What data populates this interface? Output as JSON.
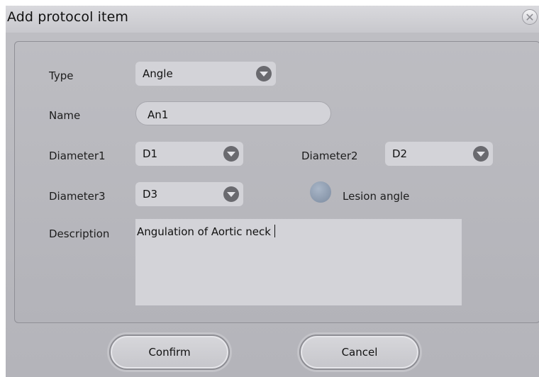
{
  "dialog": {
    "title": "Add protocol item",
    "close_icon": "close-icon"
  },
  "form": {
    "type": {
      "label": "Type",
      "value": "Angle"
    },
    "name": {
      "label": "Name",
      "value": "An1"
    },
    "diameter1": {
      "label": "Diameter1",
      "value": "D1"
    },
    "diameter2": {
      "label": "Diameter2",
      "value": "D2"
    },
    "diameter3": {
      "label": "Diameter3",
      "value": "D3"
    },
    "lesion_angle": {
      "label": "Lesion angle",
      "checked": false
    },
    "description": {
      "label": "Description",
      "value": "Angulation of Aortic neck"
    }
  },
  "buttons": {
    "confirm": "Confirm",
    "cancel": "Cancel"
  },
  "colors": {
    "background": "#b9b9be",
    "field": "#d3d3d8",
    "dropdown_arrow": "#6a6a6f",
    "radio": "#8a99ad"
  }
}
